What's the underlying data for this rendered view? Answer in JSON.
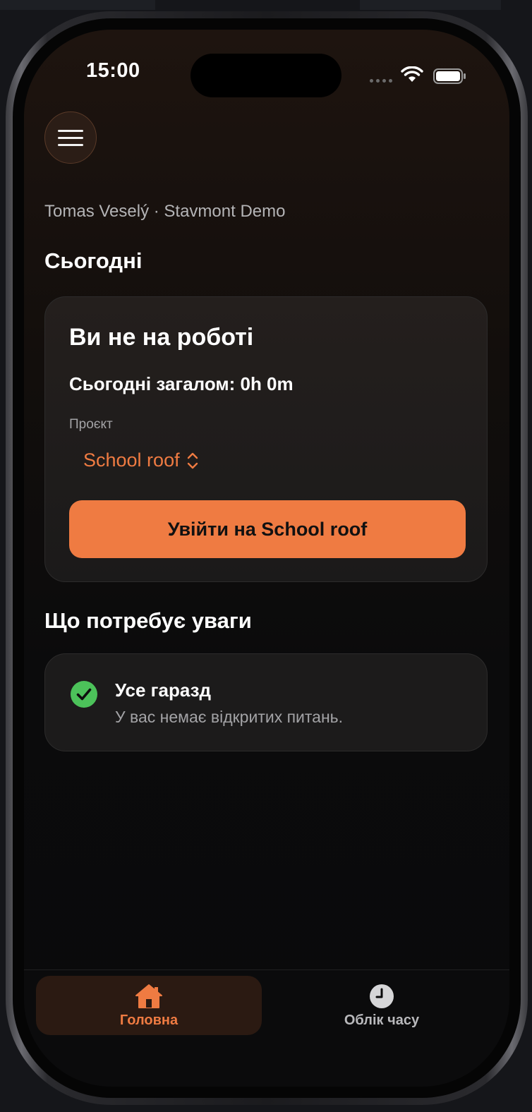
{
  "status_bar": {
    "time": "15:00"
  },
  "header": {
    "user_line": "Tomas Veselý · Stavmont Demo"
  },
  "today": {
    "section_title": "Сьогодні",
    "heading": "Ви не на роботі",
    "total": "Сьогодні загалом: 0h 0m",
    "project_label": "Проєкт",
    "project_value": "School roof",
    "clockin_label": "Увійти на School roof"
  },
  "attention": {
    "section_title": "Що потребує уваги",
    "status_title": "Усе гаразд",
    "status_sub": "У вас немає відкритих питань."
  },
  "tabs": [
    {
      "label": "Головна",
      "icon": "house-icon",
      "active": true
    },
    {
      "label": "Облік часу",
      "icon": "clock-icon",
      "active": false
    }
  ],
  "colors": {
    "accent": "#ef7b42",
    "success": "#4cc25a",
    "background": "#0a0a0b",
    "card": "#1c1b1b"
  }
}
